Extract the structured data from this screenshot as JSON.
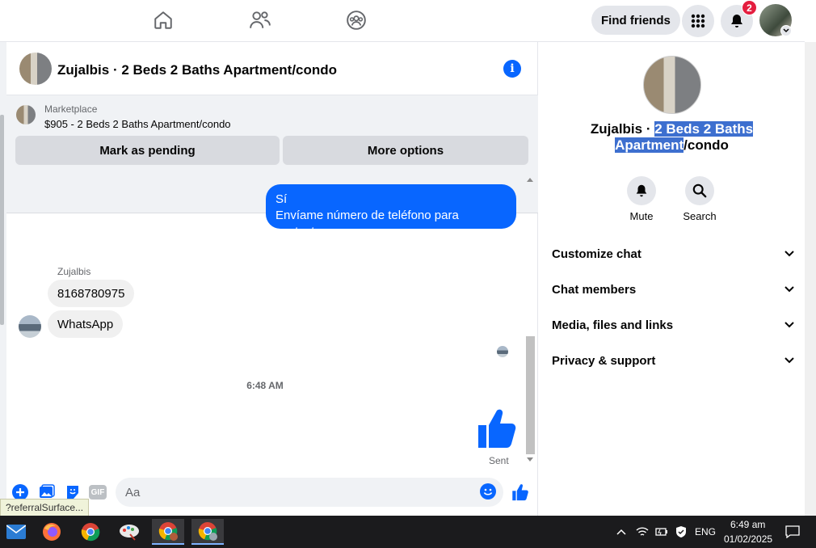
{
  "topbar": {
    "find_friends_label": "Find friends",
    "notification_count": "2",
    "icons": [
      "home-icon",
      "friends-icon",
      "groups-icon",
      "menu-grid-icon",
      "bell-icon"
    ]
  },
  "chat": {
    "header_title": "Zujalbis · 2 Beds 2 Baths Apartment/condo",
    "marketplace": {
      "label": "Marketplace",
      "price_title": "$905 - 2 Beds 2 Baths Apartment/condo",
      "mark_pending_label": "Mark as pending",
      "more_options_label": "More options"
    },
    "messages": {
      "outgoing_line1": "Sí",
      "outgoing_line2": "Envíame número de teléfono para contacto",
      "sender_name": "Zujalbis",
      "incoming_1": "8168780975",
      "incoming_2": "WhatsApp",
      "timestamp": "6:48 AM",
      "sent_status": "Sent"
    },
    "composer": {
      "placeholder": "Aa",
      "gif_label": "GIF"
    },
    "tooltip": "?referralSurface..."
  },
  "right_panel": {
    "name_plain": "Zujalbis · ",
    "name_highlight_1": "2 Beds 2 Baths",
    "name_highlight_2": "Apartment",
    "name_rest": "/condo",
    "mute_label": "Mute",
    "search_label": "Search",
    "sections": [
      "Customize chat",
      "Chat members",
      "Media, files and links",
      "Privacy & support"
    ]
  },
  "taskbar": {
    "language": "ENG",
    "time": "6:49 am",
    "date": "01/02/2025"
  },
  "colors": {
    "accent": "#0866ff",
    "badge": "#e41e3f",
    "highlight": "#3d6fcf"
  }
}
